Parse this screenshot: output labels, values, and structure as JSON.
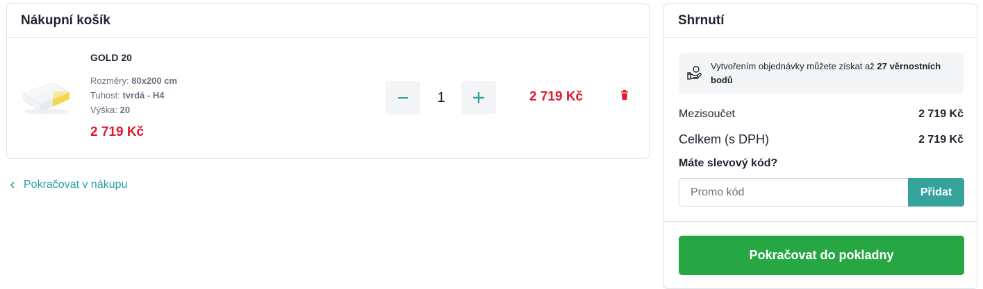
{
  "cart": {
    "title": "Nákupní košík",
    "item": {
      "name": "GOLD 20",
      "attributes": [
        {
          "label": "Rozměry:",
          "value": "80x200 cm"
        },
        {
          "label": "Tuhost:",
          "value": "tvrdá - H4"
        },
        {
          "label": "Výška:",
          "value": "20"
        }
      ],
      "unit_price": "2 719 Kč",
      "quantity": "1",
      "line_total": "2 719 Kč",
      "icons": {
        "decrease": "minus-icon",
        "increase": "plus-icon",
        "remove": "trash-icon"
      }
    },
    "continue_shopping": "Pokračovat v nákupu"
  },
  "summary": {
    "title": "Shrnutí",
    "loyalty": {
      "text_before": "Vytvořením objednávky můžete získat až ",
      "points": "27 věrnostních bodů",
      "icon": "hand-coin-icon"
    },
    "subtotal_label": "Mezisoučet",
    "subtotal_value": "2 719 Kč",
    "total_label": "Celkem (s DPH)",
    "total_value": "2 719 Kč",
    "discount_label": "Máte slevový kód?",
    "promo_placeholder": "Promo kód",
    "promo_button": "Přidat",
    "checkout_button": "Pokračovat do pokladny"
  },
  "colors": {
    "price_red": "#e3192e",
    "teal": "#35a39b",
    "link_teal": "#27a0a0",
    "checkout_green": "#27a744"
  }
}
